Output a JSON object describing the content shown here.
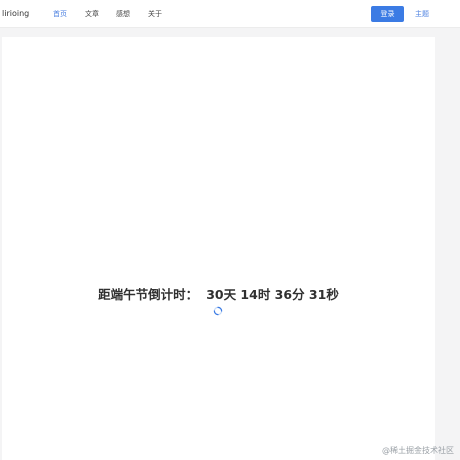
{
  "header": {
    "brand": "lirioing",
    "nav": [
      {
        "label": "首页",
        "active": true
      },
      {
        "label": "文章",
        "active": false
      },
      {
        "label": "感想",
        "active": false
      },
      {
        "label": "关于",
        "active": false
      }
    ],
    "login_label": "登录",
    "theme_label": "主题"
  },
  "main": {
    "countdown_label": "距端午节倒计时：",
    "countdown_value": "30天 14时 36分 31秒",
    "loading_icon": "loading-spinner-icon"
  },
  "watermark": "@稀土掘金技术社区",
  "colors": {
    "accent": "#3b7be4",
    "nav_active": "#4a7fe0",
    "page_bg": "#f4f4f5"
  }
}
